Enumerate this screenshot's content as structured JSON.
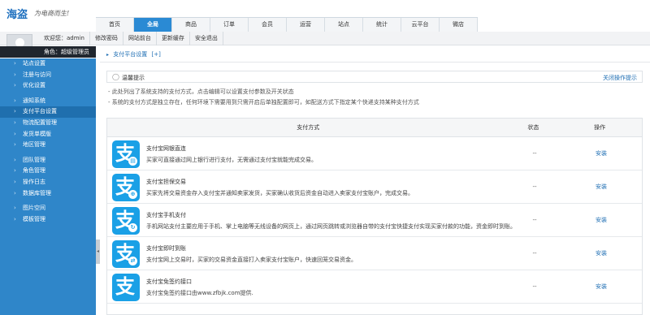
{
  "header": {
    "logo": "海盗",
    "slogan": "为电商而生!"
  },
  "nav": {
    "tabs": [
      "首页",
      "全局",
      "商品",
      "订单",
      "会员",
      "运营",
      "站点",
      "统计",
      "云平台",
      "微店"
    ],
    "active_index": 1
  },
  "subbar": {
    "links": [
      "欢迎您：admin",
      "修改密码",
      "网站前台",
      "更新缓存",
      "安全退出"
    ]
  },
  "role": {
    "label": "角色：超级管理员"
  },
  "sidebar": {
    "group1": [
      "站点设置",
      "注册与访问",
      "优化设置"
    ],
    "group2": [
      "通知系统",
      "支付平台设置",
      "物流配置管理",
      "发货单模版",
      "地区管理"
    ],
    "group3": [
      "团队管理",
      "角色管理",
      "操作日志",
      "数据库管理"
    ],
    "group4": [
      "图片空间",
      "模板管理"
    ],
    "active_label": "支付平台设置"
  },
  "breadcrumb": {
    "label": "支付平台设置",
    "extra": "[+]"
  },
  "tips": {
    "title": "温馨提示",
    "close_label": "关闭操作提示",
    "lines": [
      "- 此处列出了系统支持的支付方式，点击编辑可以设置支付参数及开关状态",
      "- 系统的支付方式是独立存在，任何环境下需要用到只需开启后单独配置即可，如配送方式下指定某个快递支持某种支付方式"
    ]
  },
  "table": {
    "headers": [
      "支付方式",
      "状态",
      "操作"
    ],
    "rows": [
      {
        "name": "支付宝网银直连",
        "desc": "买家可直接通过网上银行进行支付，无需通过支付宝就能完成交易。",
        "status": "--",
        "action": "安装",
        "badge": "▤"
      },
      {
        "name": "支付宝担保交易",
        "desc": "买家先将交易资金存入支付宝并通知卖家发货，买家确认收货后资金自动进入卖家支付宝账户，完成交易。",
        "status": "--",
        "action": "安装",
        "badge": "⊕"
      },
      {
        "name": "支付宝手机支付",
        "desc": "手机网站支付主要应用于手机、掌上电脑等无线设备的网页上，通过网页跳转或浏览器自带的支付宝快捷支付实现买家付款的功能，资金即时到账。",
        "status": "--",
        "action": "安装",
        "badge": "↻"
      },
      {
        "name": "支付宝即时到账",
        "desc": "支付宝网上交易时，买家的交易资金直接打入卖家支付宝账户，快速回笼交易资金。",
        "status": "--",
        "action": "安装",
        "badge": "⇄"
      },
      {
        "name": "支付宝免签约接口",
        "desc": "支付宝免签约接口由www.zfbjk.com提供.",
        "status": "--",
        "action": "安装",
        "badge": ""
      }
    ]
  },
  "icons": {
    "alipay_logo_glyph": "支",
    "collapse_glyph": "◂",
    "chevron_glyph": "›",
    "bulb_glyph": "◯",
    "breadcrumb_arrow": "▸"
  },
  "colors": {
    "accent": "#2a8ad4",
    "sidebar": "#2f86c9",
    "sidebar_active": "#1f6fae",
    "alipay": "#1aa0e6",
    "link": "#1d6db3"
  }
}
